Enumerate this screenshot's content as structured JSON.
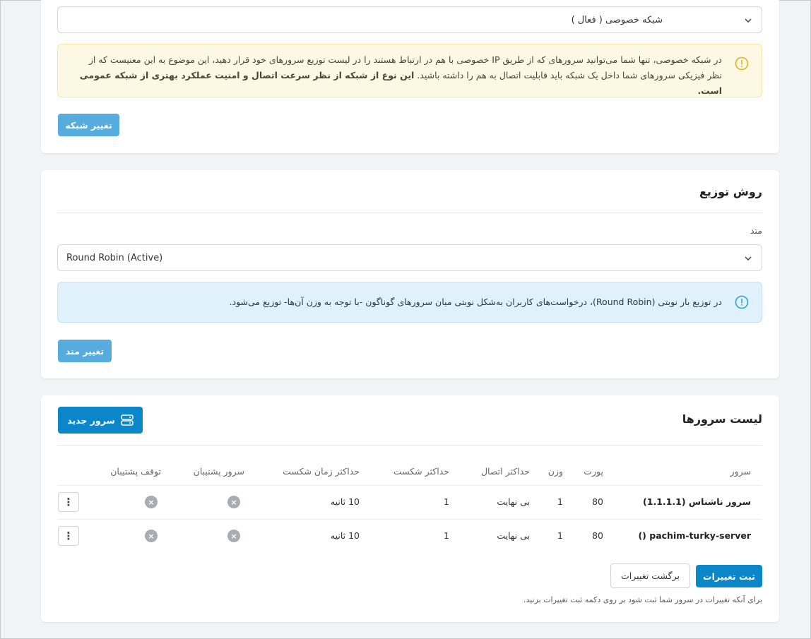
{
  "network": {
    "selected_value": "شبکه خصوصی ( فعال )",
    "alert_text": "در شبکه خصوصی، تنها شما می‌توانید سرورهای که از طریق IP خصوصی با هم در ارتباط هستند را در لیست توزیع سرورهای خود قرار دهید، این موضوع به این معنیست که از نظر فیزیکی سرورهای شما داخل یک شبکه باید قابلیت اتصال به هم را داشته باشید.",
    "alert_bold": "این نوع از شبکه از نظر سرعت اتصال و امنیت عملکرد بهتری از شبکه عمومی است.",
    "change_button": "تغییر شبکه"
  },
  "distribution": {
    "title": "روش توزیع",
    "method_label": "متد",
    "selected_value": "Round Robin (Active)",
    "alert_text": "در توزیع بار نوبتی (Round Robin)، درخواست‌های کاربران به‌شکل نوبتی میان سرورهای گوناگون -با توجه به وزن آن‌ها- توزیع می‌شود.",
    "change_button": "تغییر متد"
  },
  "servers": {
    "title": "لیست سرورها",
    "new_button": "سرور جدید",
    "columns": {
      "server": "سرور",
      "port": "پورت",
      "weight": "وزن",
      "max_conn": "حداکثر اتصال",
      "max_fail": "حداکثر شکست",
      "fail_timeout": "حداکثر زمان شکست",
      "backup": "سرور پشتیبان",
      "backup_stop": "توقف پشتیبان"
    },
    "rows": [
      {
        "server": "سرور ناشناس (1.1.1.1)",
        "port": "80",
        "weight": "1",
        "max_conn": "بی نهایت",
        "max_fail": "1",
        "fail_timeout": "10 ثانیه"
      },
      {
        "server": "pachim-turky-server ()",
        "port": "80",
        "weight": "1",
        "max_conn": "بی نهایت",
        "max_fail": "1",
        "fail_timeout": "10 ثانیه"
      }
    ],
    "row_menu_glyph": "⋮",
    "x_glyph": "×",
    "save_button": "ثبت تغییرات",
    "revert_button": "برگشت تغییرات",
    "footer_note": "برای آنکه تغییرات در سرور شما ثبت شود بر روی دکمه ثبت تغییرات بزنید."
  }
}
